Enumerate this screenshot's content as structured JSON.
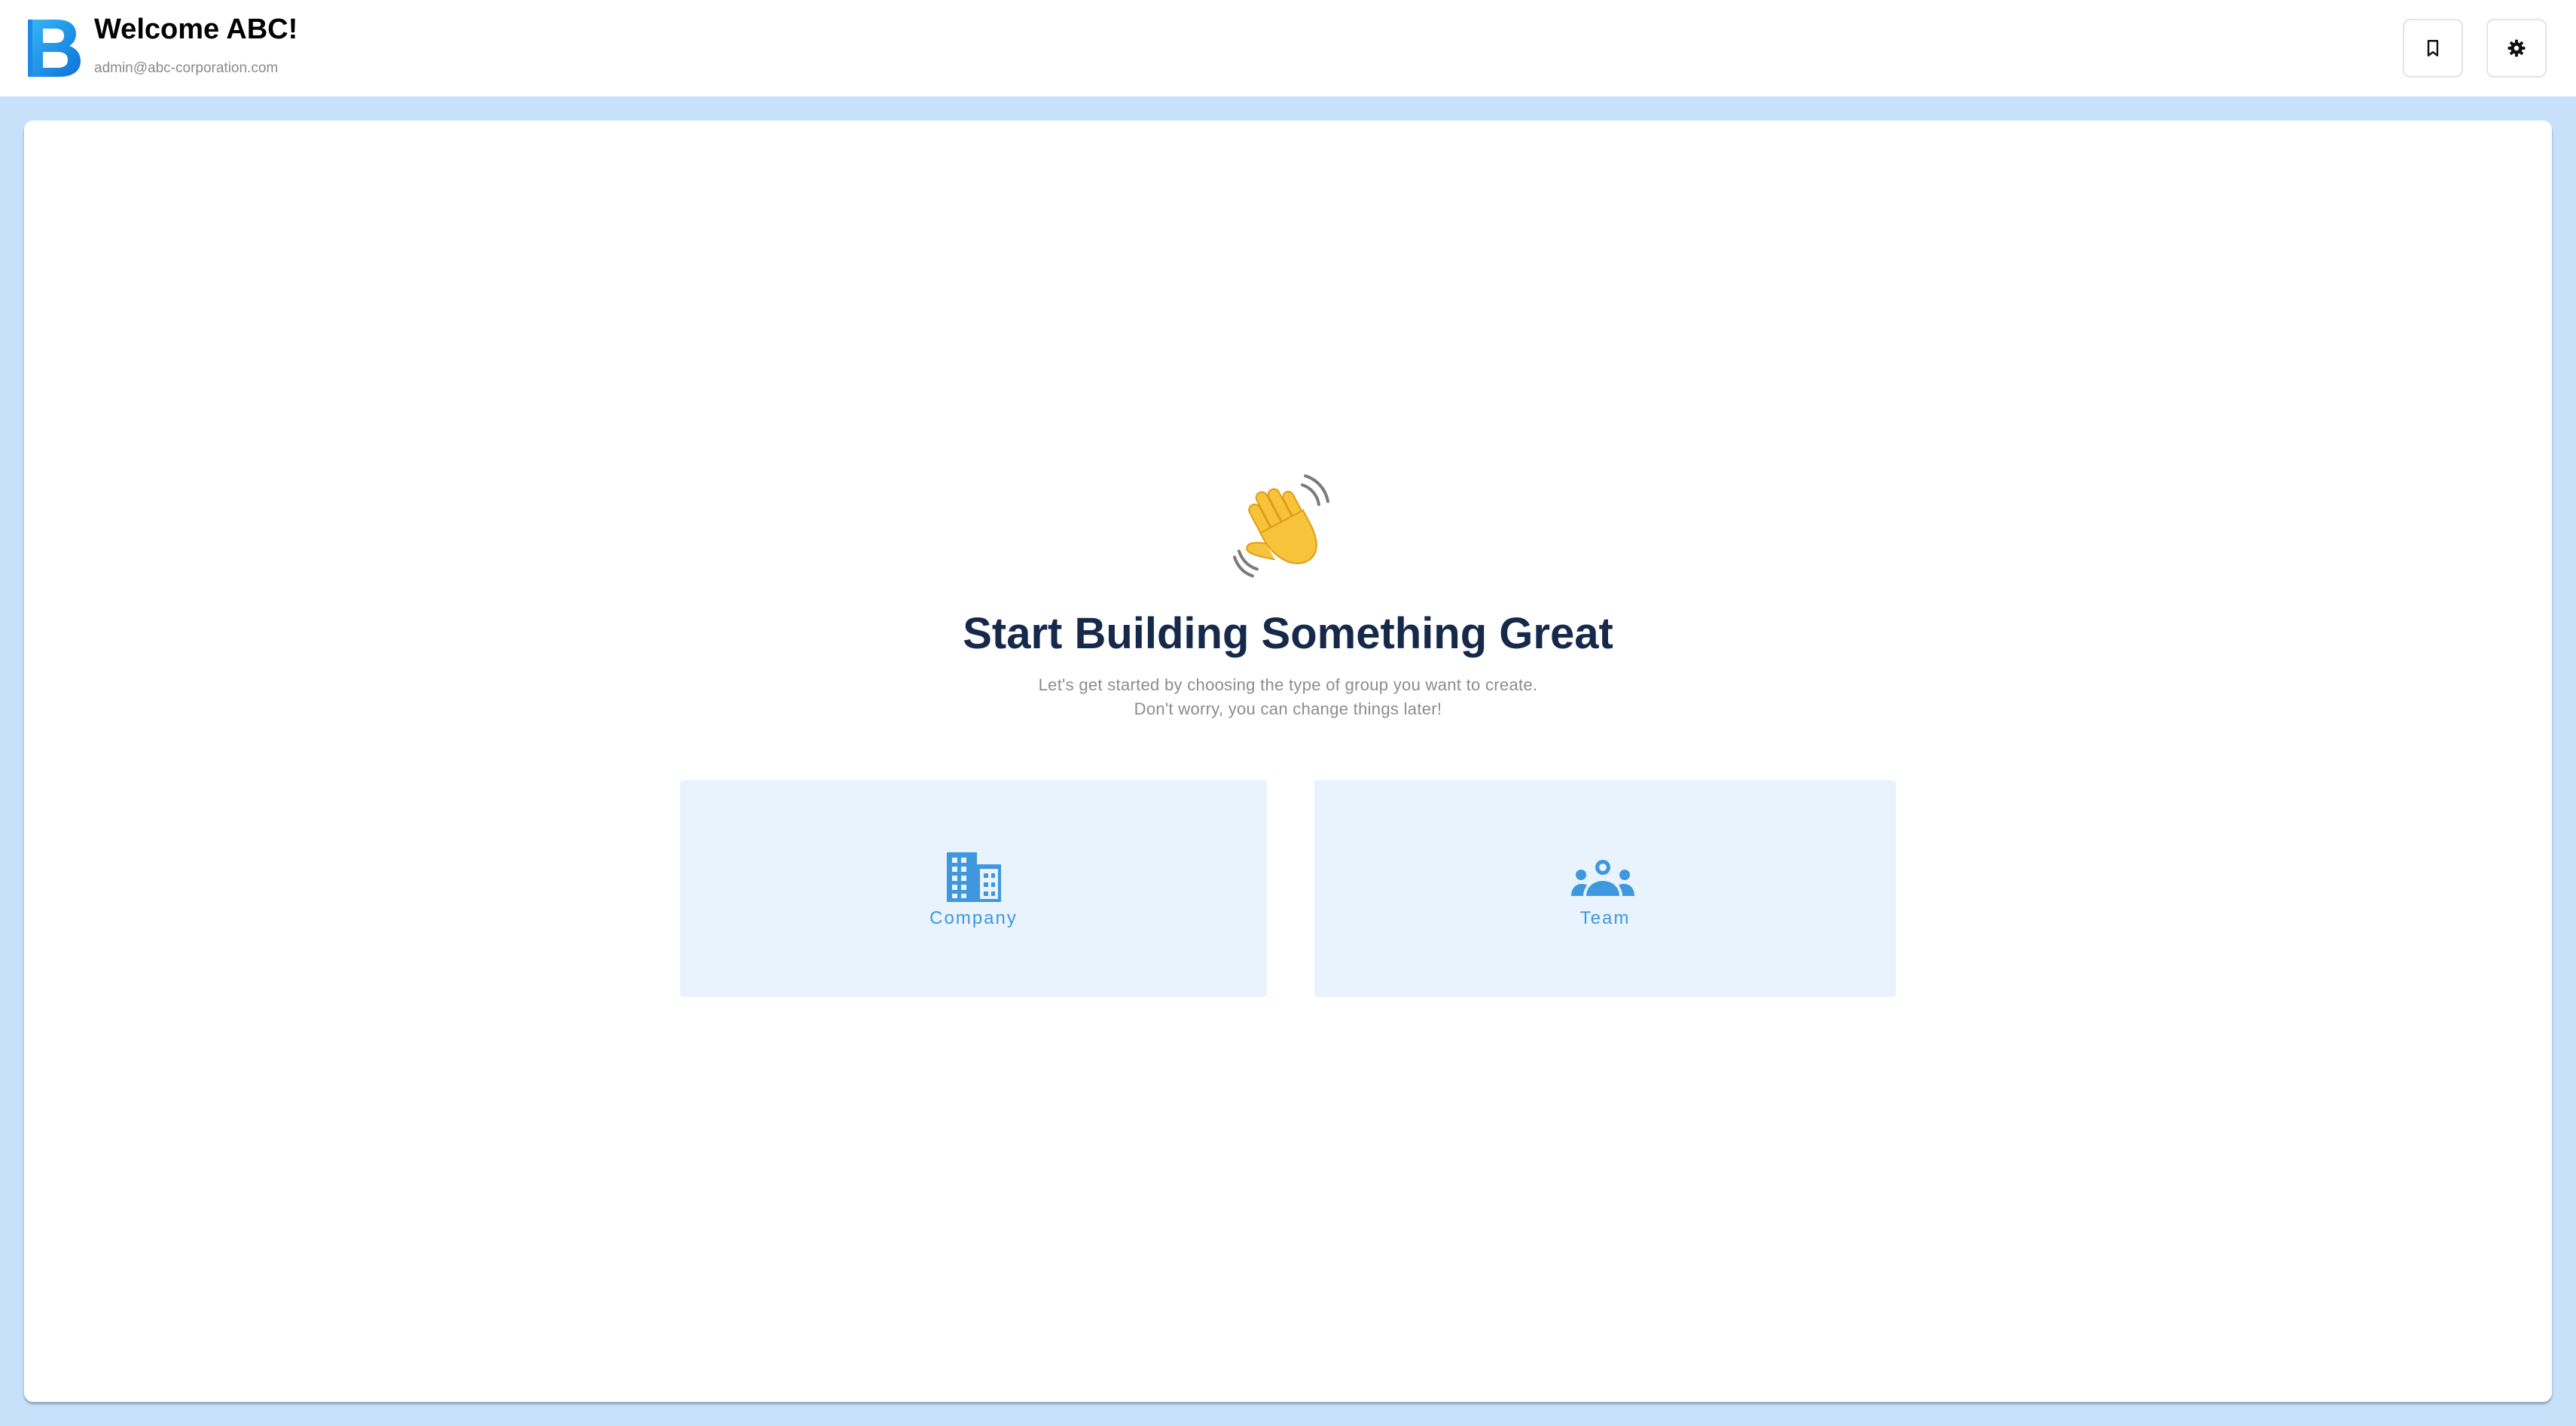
{
  "header": {
    "logo_icon": "b-letter-logo-icon",
    "title": "Welcome ABC!",
    "email": "admin@abc-corporation.com",
    "actions": [
      {
        "icon": "bookmark-icon"
      },
      {
        "icon": "gear-icon"
      }
    ]
  },
  "main": {
    "emoji_icon": "waving-hand-icon",
    "headline": "Start Building Something Great",
    "subtitle_line1": "Let's get started by choosing the type of group you want to create.",
    "subtitle_line2": "Don't worry, you can change things later!",
    "options": [
      {
        "label": "Company",
        "icon": "building-icon"
      },
      {
        "label": "Team",
        "icon": "team-icon"
      }
    ]
  },
  "colors": {
    "page_background": "#c8e1fb",
    "accent": "#3f98dd",
    "headline": "#16294a",
    "option_background": "#e8f3fe"
  }
}
